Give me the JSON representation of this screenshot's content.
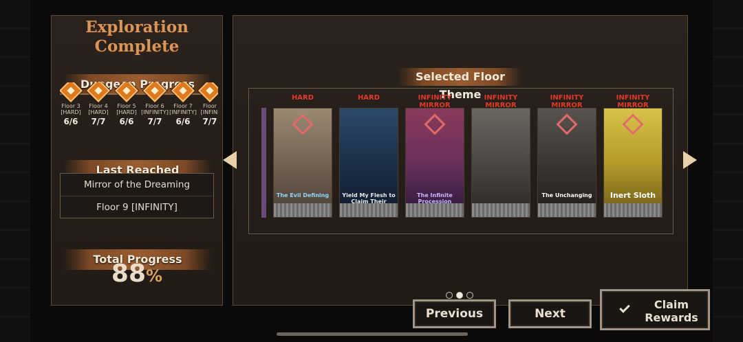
{
  "left": {
    "title_line1": "Exploration",
    "title_line2": "Complete",
    "dungeon_progress_label": "Dungeon Progress",
    "floors": [
      {
        "name1": "Floor 3",
        "name2": "[HARD]",
        "score": "6/6"
      },
      {
        "name1": "Floor 4",
        "name2": "[HARD]",
        "score": "7/7"
      },
      {
        "name1": "Floor 5",
        "name2": "[HARD]",
        "score": "6/6"
      },
      {
        "name1": "Floor 6",
        "name2": "[INFINITY]",
        "score": "7/7"
      },
      {
        "name1": "Floor 7",
        "name2": "[INFINITY]",
        "score": "6/6"
      },
      {
        "name1": "Floor",
        "name2": "[INFINI",
        "score": "7/7"
      }
    ],
    "last_reached_label": "Last Reached",
    "last_reached_name": "Mirror of the Dreaming",
    "last_reached_floor": "Floor 9 [INFINITY]",
    "total_progress_label": "Total Progress",
    "total_progress_value": "88",
    "total_progress_unit": "%"
  },
  "right": {
    "selected_floor_theme_label": "Selected Floor Theme",
    "cards": [
      {
        "difficulty": "HARD",
        "caption": "The Evil Defining",
        "bg": "#7a6a5a",
        "accent": "#c89a6a"
      },
      {
        "difficulty": "HARD",
        "caption": "Yield My Flesh to Claim Their Bones Settled",
        "bg": "#1c2f4a",
        "accent": "#3a6e8a"
      },
      {
        "difficulty": "INFINITY MIRROR",
        "caption": "The Infinite Procession",
        "bg": "#6a2f5a",
        "accent": "#9a4a7a"
      },
      {
        "difficulty": "INFINITY MIRROR",
        "caption": "",
        "bg": "#4a4744",
        "accent": "#8a8175"
      },
      {
        "difficulty": "INFINITY MIRROR",
        "caption": "The Unchanging",
        "bg": "#3a3633",
        "accent": "#6a625a"
      },
      {
        "difficulty": "INFINITY MIRROR",
        "caption": "Inert Sloth",
        "bg": "#b59a2a",
        "accent": "#d9c24a"
      }
    ],
    "page_indicator": {
      "pages": 3,
      "active": 2
    }
  },
  "buttons": {
    "previous": "Previous",
    "next": "Next",
    "claim_line1": "Claim",
    "claim_line2": "Rewards"
  }
}
